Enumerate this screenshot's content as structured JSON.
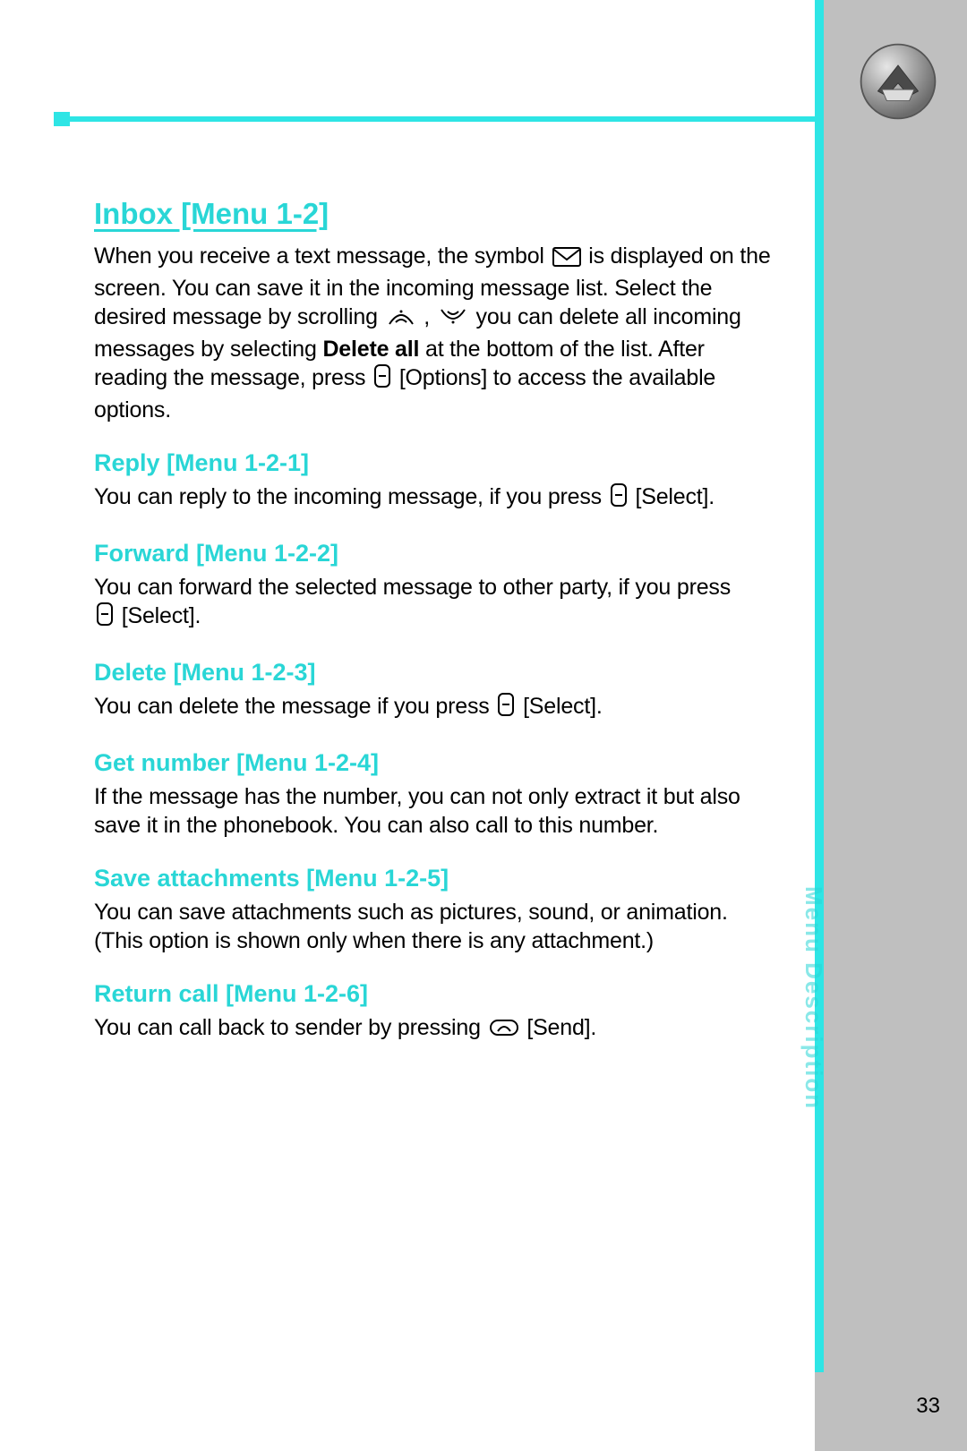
{
  "page_number": "33",
  "side_label": "Menu Description",
  "h1": "Inbox [Menu 1-2]",
  "intro": {
    "frag1": "When you receive a text message, the symbol ",
    "frag2": " is displayed on the screen. You can save it in the incoming message list. Select the desired message by scrolling ",
    "frag_comma": " , ",
    "frag3": " you can delete all incoming messages by selecting ",
    "bold_delete_all": "Delete all",
    "frag4": " at the bottom of the list. After reading the message, press ",
    "frag5": " [Options] to access the available options."
  },
  "sections": {
    "reply": {
      "title": "Reply [Menu 1-2-1]",
      "body_a": "You can reply to the incoming message, if you press ",
      "body_b": " [Select]."
    },
    "forward": {
      "title": "Forward [Menu 1-2-2]",
      "body_a": "You can forward the selected message to other party, if you press ",
      "body_b": " [Select]."
    },
    "delete": {
      "title": "Delete [Menu 1-2-3]",
      "body_a": "You can delete the message if you press ",
      "body_b": " [Select]."
    },
    "getnumber": {
      "title": "Get number [Menu 1-2-4]",
      "body": "If the message has the number, you can not only extract it but also save it in the phonebook. You can also call to this number."
    },
    "saveatt": {
      "title": "Save attachments [Menu 1-2-5]",
      "body": "You can save attachments such as pictures, sound, or animation. (This option is shown only when there is any attachment.)"
    },
    "returncall": {
      "title": "Return call [Menu 1-2-6]",
      "body_a": "You can call back to sender by pressing ",
      "body_b": " [Send]."
    }
  },
  "icons": {
    "envelope": "envelope-icon",
    "scroll_up": "scroll-up-icon",
    "scroll_down": "scroll-down-icon",
    "softkey": "softkey-icon",
    "send": "send-key-icon",
    "corner": "mail-corner-icon"
  },
  "colors": {
    "accent": "#2ee5e5",
    "grey": "#bfbfbf"
  }
}
